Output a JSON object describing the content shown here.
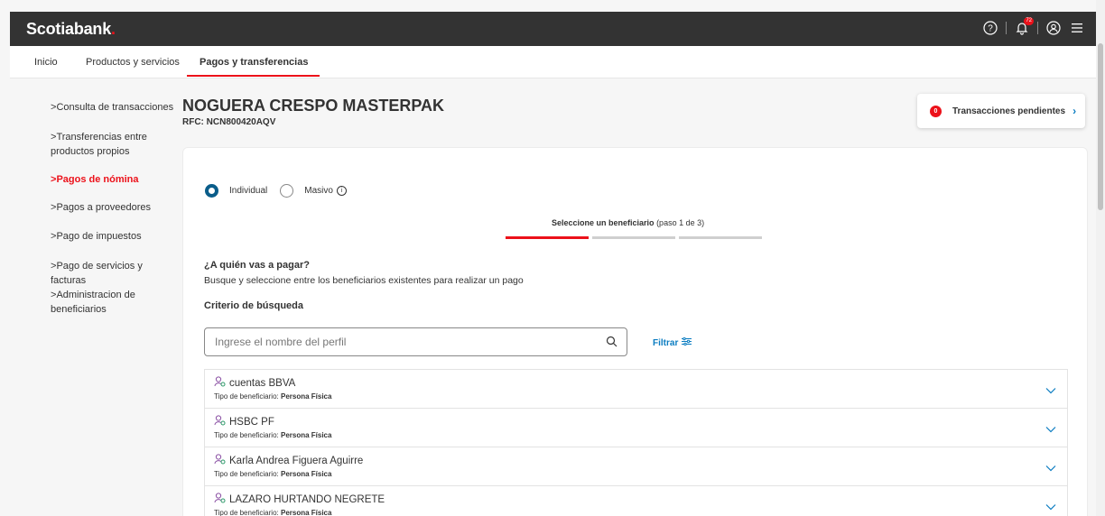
{
  "header": {
    "brand": "Scotiabank",
    "brand_dot": ".",
    "notification_count": "72",
    "icons": [
      "help-icon",
      "bell-icon",
      "user-icon",
      "menu-icon"
    ],
    "accent_color": "#ec111a"
  },
  "nav": {
    "items": [
      {
        "label": "Inicio"
      },
      {
        "label": "Productos y servicios"
      },
      {
        "label": "Pagos y transferencias"
      }
    ]
  },
  "sidebar": {
    "items": [
      {
        "label": "Consulta de transacciones"
      },
      {
        "label": "Transferencias entre productos propios"
      },
      {
        "label": "Pagos de nómina"
      },
      {
        "label": "Pagos a proveedores"
      },
      {
        "label": "Pago de impuestos"
      },
      {
        "label": "Pago de servicios y facturas"
      },
      {
        "label": "Administracion de beneficiarios"
      }
    ],
    "active": "Pagos de nómina"
  },
  "company": {
    "name": "NOGUERA CRESPO MASTERPAK",
    "rfc": "RFC: NCN800420AQV"
  },
  "pending": {
    "count": "0",
    "label": "Transacciones pendientes"
  },
  "mode": {
    "individual": "Individual",
    "masivo": "Masivo",
    "selected": "Individual"
  },
  "stepper": {
    "title": "Seleccione un beneficiario",
    "progress": "(paso 1 de 3)",
    "current_step": 1,
    "total_steps": 3
  },
  "search": {
    "question": "¿A quién vas a pagar?",
    "description": "Busque y seleccione entre los beneficiarios existentes para realizar un pago",
    "criteria_label": "Criterio de búsqueda",
    "placeholder": "Ingrese el nombre del perfil",
    "filter_label": "Filtrar"
  },
  "beneficiaries": [
    {
      "name": "cuentas BBVA",
      "type_label": "Tipo de beneficiario:",
      "type": "Persona Física"
    },
    {
      "name": "HSBC PF",
      "type_label": "Tipo de beneficiario:",
      "type": "Persona Física"
    },
    {
      "name": "Karla Andrea Figuera Aguirre",
      "type_label": "Tipo de beneficiario:",
      "type": "Persona Física"
    },
    {
      "name": "LAZARO HURTANDO NEGRETE",
      "type_label": "Tipo de beneficiario:",
      "type": "Persona Física"
    }
  ]
}
